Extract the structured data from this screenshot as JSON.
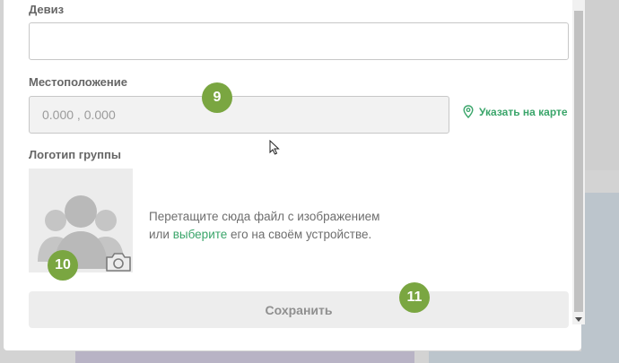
{
  "form": {
    "motto": {
      "label": "Девиз",
      "value": ""
    },
    "location": {
      "label": "Местоположение",
      "placeholder": "0.000 , 0.000",
      "map_link": "Указать на карте"
    },
    "logo": {
      "label": "Логотип группы",
      "drop_text_before": "Перетащите сюда файл с изображением",
      "drop_text_or": "или ",
      "drop_link": "выберите",
      "drop_text_after": " его на своём устройстве."
    },
    "save_label": "Сохранить"
  },
  "badges": {
    "b9": "9",
    "b10": "10",
    "b11": "11"
  },
  "colors": {
    "accent": "#3aa56a",
    "badge": "#7aa641",
    "button_bg": "#ededed",
    "input_disabled_bg": "#f2f2f2"
  },
  "icons": [
    "map-pin-icon",
    "camera-icon",
    "user-group-placeholder-icon",
    "mouse-cursor-icon"
  ]
}
